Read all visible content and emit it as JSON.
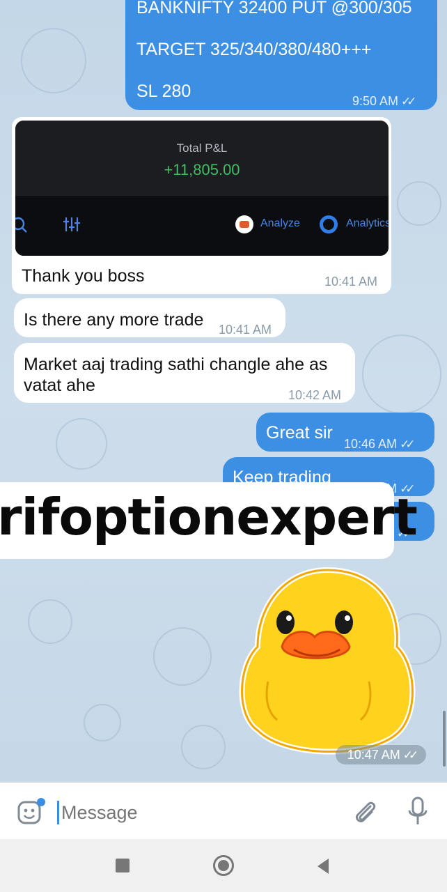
{
  "messages": {
    "signal": {
      "line1": "BANKNIFTY 32400 PUT @300/305",
      "line2": "TARGET 325/340/380/480+++",
      "line3": "SL 280",
      "time": "9:50 AM"
    },
    "screenshot": {
      "pnl_label": "Total P&L",
      "pnl_value": "+11,805.00",
      "analyze_label": "Analyze",
      "analytics_label": "Analytics",
      "caption": "Thank you boss",
      "time": "10:41 AM"
    },
    "in1": {
      "text": "Is there any more trade",
      "time": "10:41 AM"
    },
    "in2": {
      "line1": "Market aaj trading sathi changle ahe as",
      "line2": "vatat ahe",
      "time": "10:42 AM"
    },
    "out1": {
      "text": "Great sir",
      "time": "10:46 AM"
    },
    "out2": {
      "text": "Keep trading",
      "time": "10:46 AM"
    },
    "sticker_time": "10:47 AM"
  },
  "watermark": "rifoptionexpert",
  "input": {
    "placeholder": "Message"
  },
  "icons": [
    "double-check-icon",
    "emoji-sticker-icon",
    "attach-icon",
    "mic-icon",
    "search-icon",
    "filter-icon",
    "nav-square-icon",
    "nav-home-icon",
    "nav-back-icon"
  ],
  "colors": {
    "outgoing": "#3d8fe4",
    "incoming": "#ffffff",
    "profit": "#3fbf5f",
    "accent": "#2f80d8"
  }
}
